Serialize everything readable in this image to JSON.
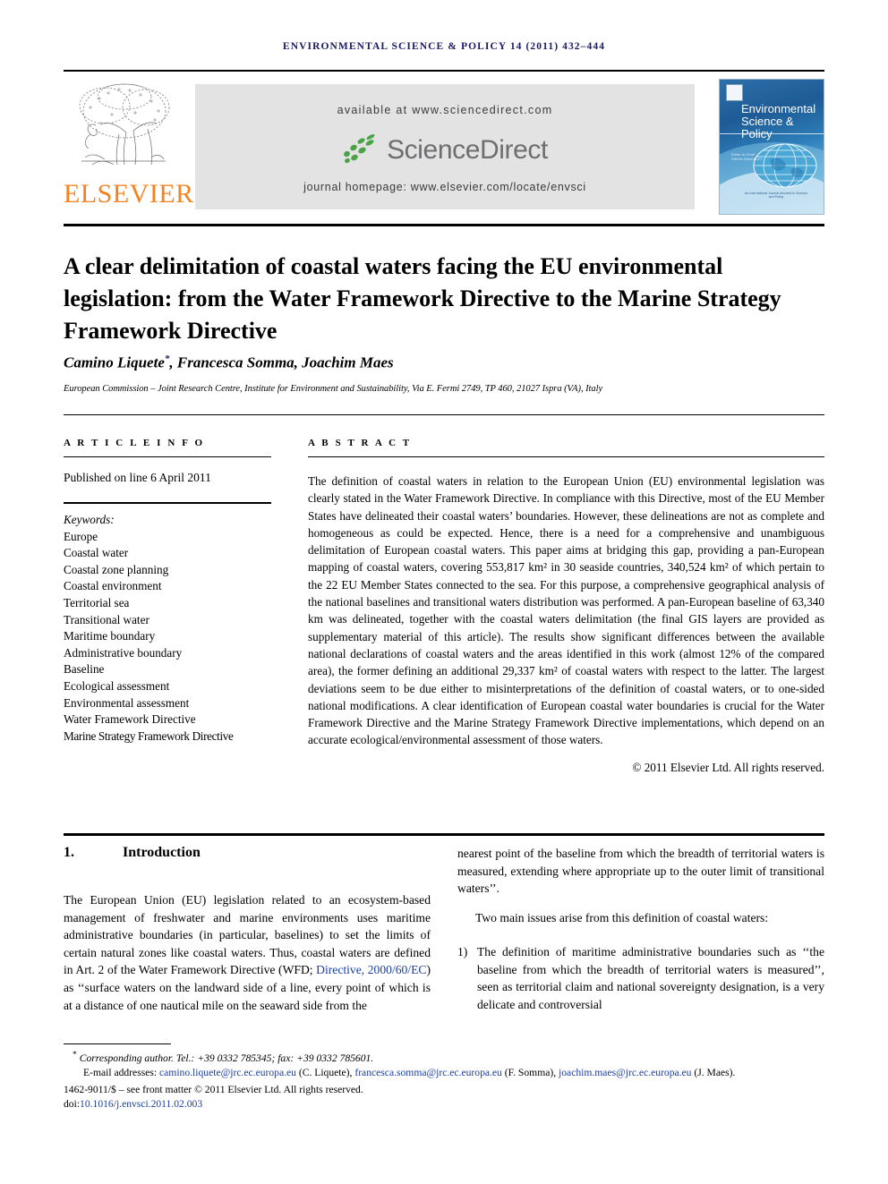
{
  "running_head": "ENVIRONMENTAL SCIENCE & POLICY 14 (2011) 432–444",
  "masthead": {
    "publisher": "ELSEVIER",
    "available_at": "available at www.sciencedirect.com",
    "sciencedirect": "ScienceDirect",
    "journal_homepage": "journal homepage: www.elsevier.com/locate/envsci",
    "cover": {
      "title_line1": "Environmental",
      "title_line2": "Science &",
      "title_line3": "Policy",
      "editor_label": "Editor-in-Chief",
      "editor_name": "SIMON SHACKLEY",
      "footer_text": "An International Journal devoted to Science and Policy"
    }
  },
  "article": {
    "title": "A clear delimitation of coastal waters facing the EU environmental legislation: from the Water Framework Directive to the Marine Strategy Framework Directive",
    "authors": "Camino Liquete",
    "authors_rest": ", Francesca Somma, Joachim Maes",
    "corresponding_marker": "*",
    "affiliation": "European Commission – Joint Research Centre, Institute for Environment and Sustainability, Via E. Fermi 2749, TP 460, 21027 Ispra (VA), Italy"
  },
  "info": {
    "heading": "A R T I C L E   I N F O",
    "published": "Published on line 6 April 2011",
    "keywords_label": "Keywords:",
    "keywords": [
      "Europe",
      "Coastal water",
      "Coastal zone planning",
      "Coastal environment",
      "Territorial sea",
      "Transitional water",
      "Maritime boundary",
      "Administrative boundary",
      "Baseline",
      "Ecological assessment",
      "Environmental assessment",
      "Water Framework Directive",
      "Marine Strategy Framework Directive"
    ]
  },
  "abstract": {
    "heading": "A B S T R A C T",
    "body": "The definition of coastal waters in relation to the European Union (EU) environmental legislation was clearly stated in the Water Framework Directive. In compliance with this Directive, most of the EU Member States have delineated their coastal waters’ boundaries. However, these delineations are not as complete and homogeneous as could be expected. Hence, there is a need for a comprehensive and unambiguous delimitation of European coastal waters. This paper aims at bridging this gap, providing a pan-European mapping of coastal waters, covering 553,817 km² in 30 seaside countries, 340,524 km² of which pertain to the 22 EU Member States connected to the sea. For this purpose, a comprehensive geographical analysis of the national baselines and transitional waters distribution was performed. A pan-European baseline of 63,340 km was delineated, together with the coastal waters delimitation (the final GIS layers are provided as supplementary material of this article). The results show significant differences between the available national declarations of coastal waters and the areas identified in this work (almost 12% of the compared area), the former defining an additional 29,337 km² of coastal waters with respect to the latter. The largest deviations seem to be due either to misinterpretations of the definition of coastal waters, or to one-sided national modifications. A clear identification of European coastal water boundaries is crucial for the Water Framework Directive and the Marine Strategy Framework Directive implementations, which depend on an accurate ecological/environmental assessment of those waters.",
    "copyright": "© 2011 Elsevier Ltd. All rights reserved."
  },
  "body": {
    "section_number": "1.",
    "section_title": "Introduction",
    "left_p1_a": "The European Union (EU) legislation related to an ecosystem-based management of freshwater and marine environments uses maritime administrative boundaries (in particular, baselines) to set the limits of certain natural zones like coastal waters. Thus, coastal waters are defined in Art. 2 of the Water Framework Directive (WFD; ",
    "left_p1_link": "Directive, 2000/60/EC",
    "left_p1_b": ") as ‘‘surface waters on the landward side of a line, every point of which is at a distance of one nautical mile on the seaward side from the",
    "right_p1": "nearest point of the baseline from which the breadth of territorial waters is measured, extending where appropriate up to the outer limit of transitional waters’’.",
    "right_p2": "Two main issues arise from this definition of coastal waters:",
    "right_list_num": "1)",
    "right_list_text": "The definition of maritime administrative boundaries such as ‘‘the baseline from which the breadth of territorial waters is measured’’, seen as territorial claim and national sovereignty designation, is a very delicate and controversial"
  },
  "footnotes": {
    "corr_marker": "*",
    "corr_text": "Corresponding author. Tel.: +39 0332 785345; fax: +39 0332 785601.",
    "email_label": "E-mail addresses:",
    "email1": "camino.liquete@jrc.ec.europa.eu",
    "email1_name": " (C. Liquete), ",
    "email2": "francesca.somma@jrc.ec.europa.eu",
    "email2_name": " (F. Somma), ",
    "email3": "joachim.maes@jrc.ec.europa.eu",
    "email3_name": " (J. Maes).",
    "issn_line": "1462-9011/$ – see front matter © 2011 Elsevier Ltd. All rights reserved.",
    "doi_prefix": "doi:",
    "doi": "10.1016/j.envsci.2011.02.003"
  },
  "colors": {
    "link": "#1a3fa0",
    "elsevier_orange": "#F58220",
    "sciencedirect_green": "#4aa346",
    "banner_gray": "#e3e3e3"
  }
}
